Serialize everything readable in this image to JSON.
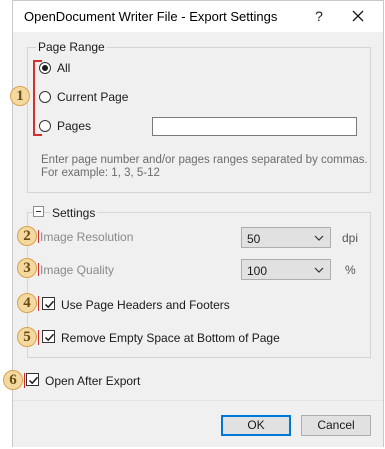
{
  "dialog": {
    "title": "OpenDocument Writer File - Export Settings",
    "help_label": "?"
  },
  "page_range": {
    "legend": "Page Range",
    "options": [
      {
        "label": "All",
        "selected": true
      },
      {
        "label": "Current Page",
        "selected": false
      },
      {
        "label": "Pages",
        "selected": false
      }
    ],
    "pages_value": "",
    "hint_line1": "Enter page number and/or pages ranges separated by commas.",
    "hint_line2": "For example: 1, 3, 5-12"
  },
  "settings": {
    "legend": "Settings",
    "collapse_symbol": "−",
    "image_resolution": {
      "label": "Image Resolution",
      "value": "50",
      "unit": "dpi"
    },
    "image_quality": {
      "label": "Image Quality",
      "value": "100",
      "unit": "%"
    },
    "use_headers_footers": {
      "label": "Use Page Headers and Footers",
      "checked": true
    },
    "remove_empty_space": {
      "label": "Remove Empty Space at Bottom of Page",
      "checked": true
    }
  },
  "open_after_export": {
    "label": "Open After Export",
    "checked": true
  },
  "buttons": {
    "ok": "OK",
    "cancel": "Cancel"
  },
  "callouts": [
    "1",
    "2",
    "3",
    "4",
    "5",
    "6"
  ],
  "colors": {
    "callout_fill": "#f3d9a0",
    "callout_border": "#d9a24a",
    "marker_red": "#d62e2e",
    "accent": "#0078d7"
  }
}
